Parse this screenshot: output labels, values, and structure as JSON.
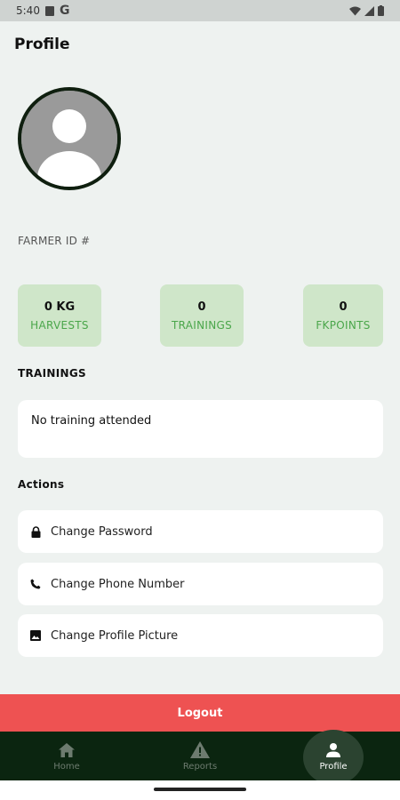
{
  "status_bar": {
    "time": "5:40",
    "carrier_glyph": "G"
  },
  "header": {
    "title": "Profile"
  },
  "profile": {
    "farmer_id_label": "FARMER ID #"
  },
  "stats": [
    {
      "value": "0 KG",
      "label": "HARVESTS"
    },
    {
      "value": "0",
      "label": "TRAININGS"
    },
    {
      "value": "0",
      "label": "FKPOINTS"
    }
  ],
  "trainings": {
    "heading": "TRAININGS",
    "empty_text": "No training attended"
  },
  "actions": {
    "heading": "Actions",
    "items": [
      {
        "label": "Change Password",
        "icon": "lock-icon"
      },
      {
        "label": "Change Phone Number",
        "icon": "phone-icon"
      },
      {
        "label": "Change Profile Picture",
        "icon": "image-icon"
      }
    ]
  },
  "logout": {
    "label": "Logout"
  },
  "bottom_nav": {
    "items": [
      {
        "label": "Home",
        "icon": "home-icon"
      },
      {
        "label": "Reports",
        "icon": "warning-icon"
      },
      {
        "label": "Profile",
        "icon": "person-icon",
        "active": true
      }
    ]
  },
  "colors": {
    "background": "#eef2f0",
    "stat_card": "#cfe6c9",
    "stat_label": "#4aa64a",
    "logout": "#ee5252",
    "nav_bar": "#0b2510"
  }
}
